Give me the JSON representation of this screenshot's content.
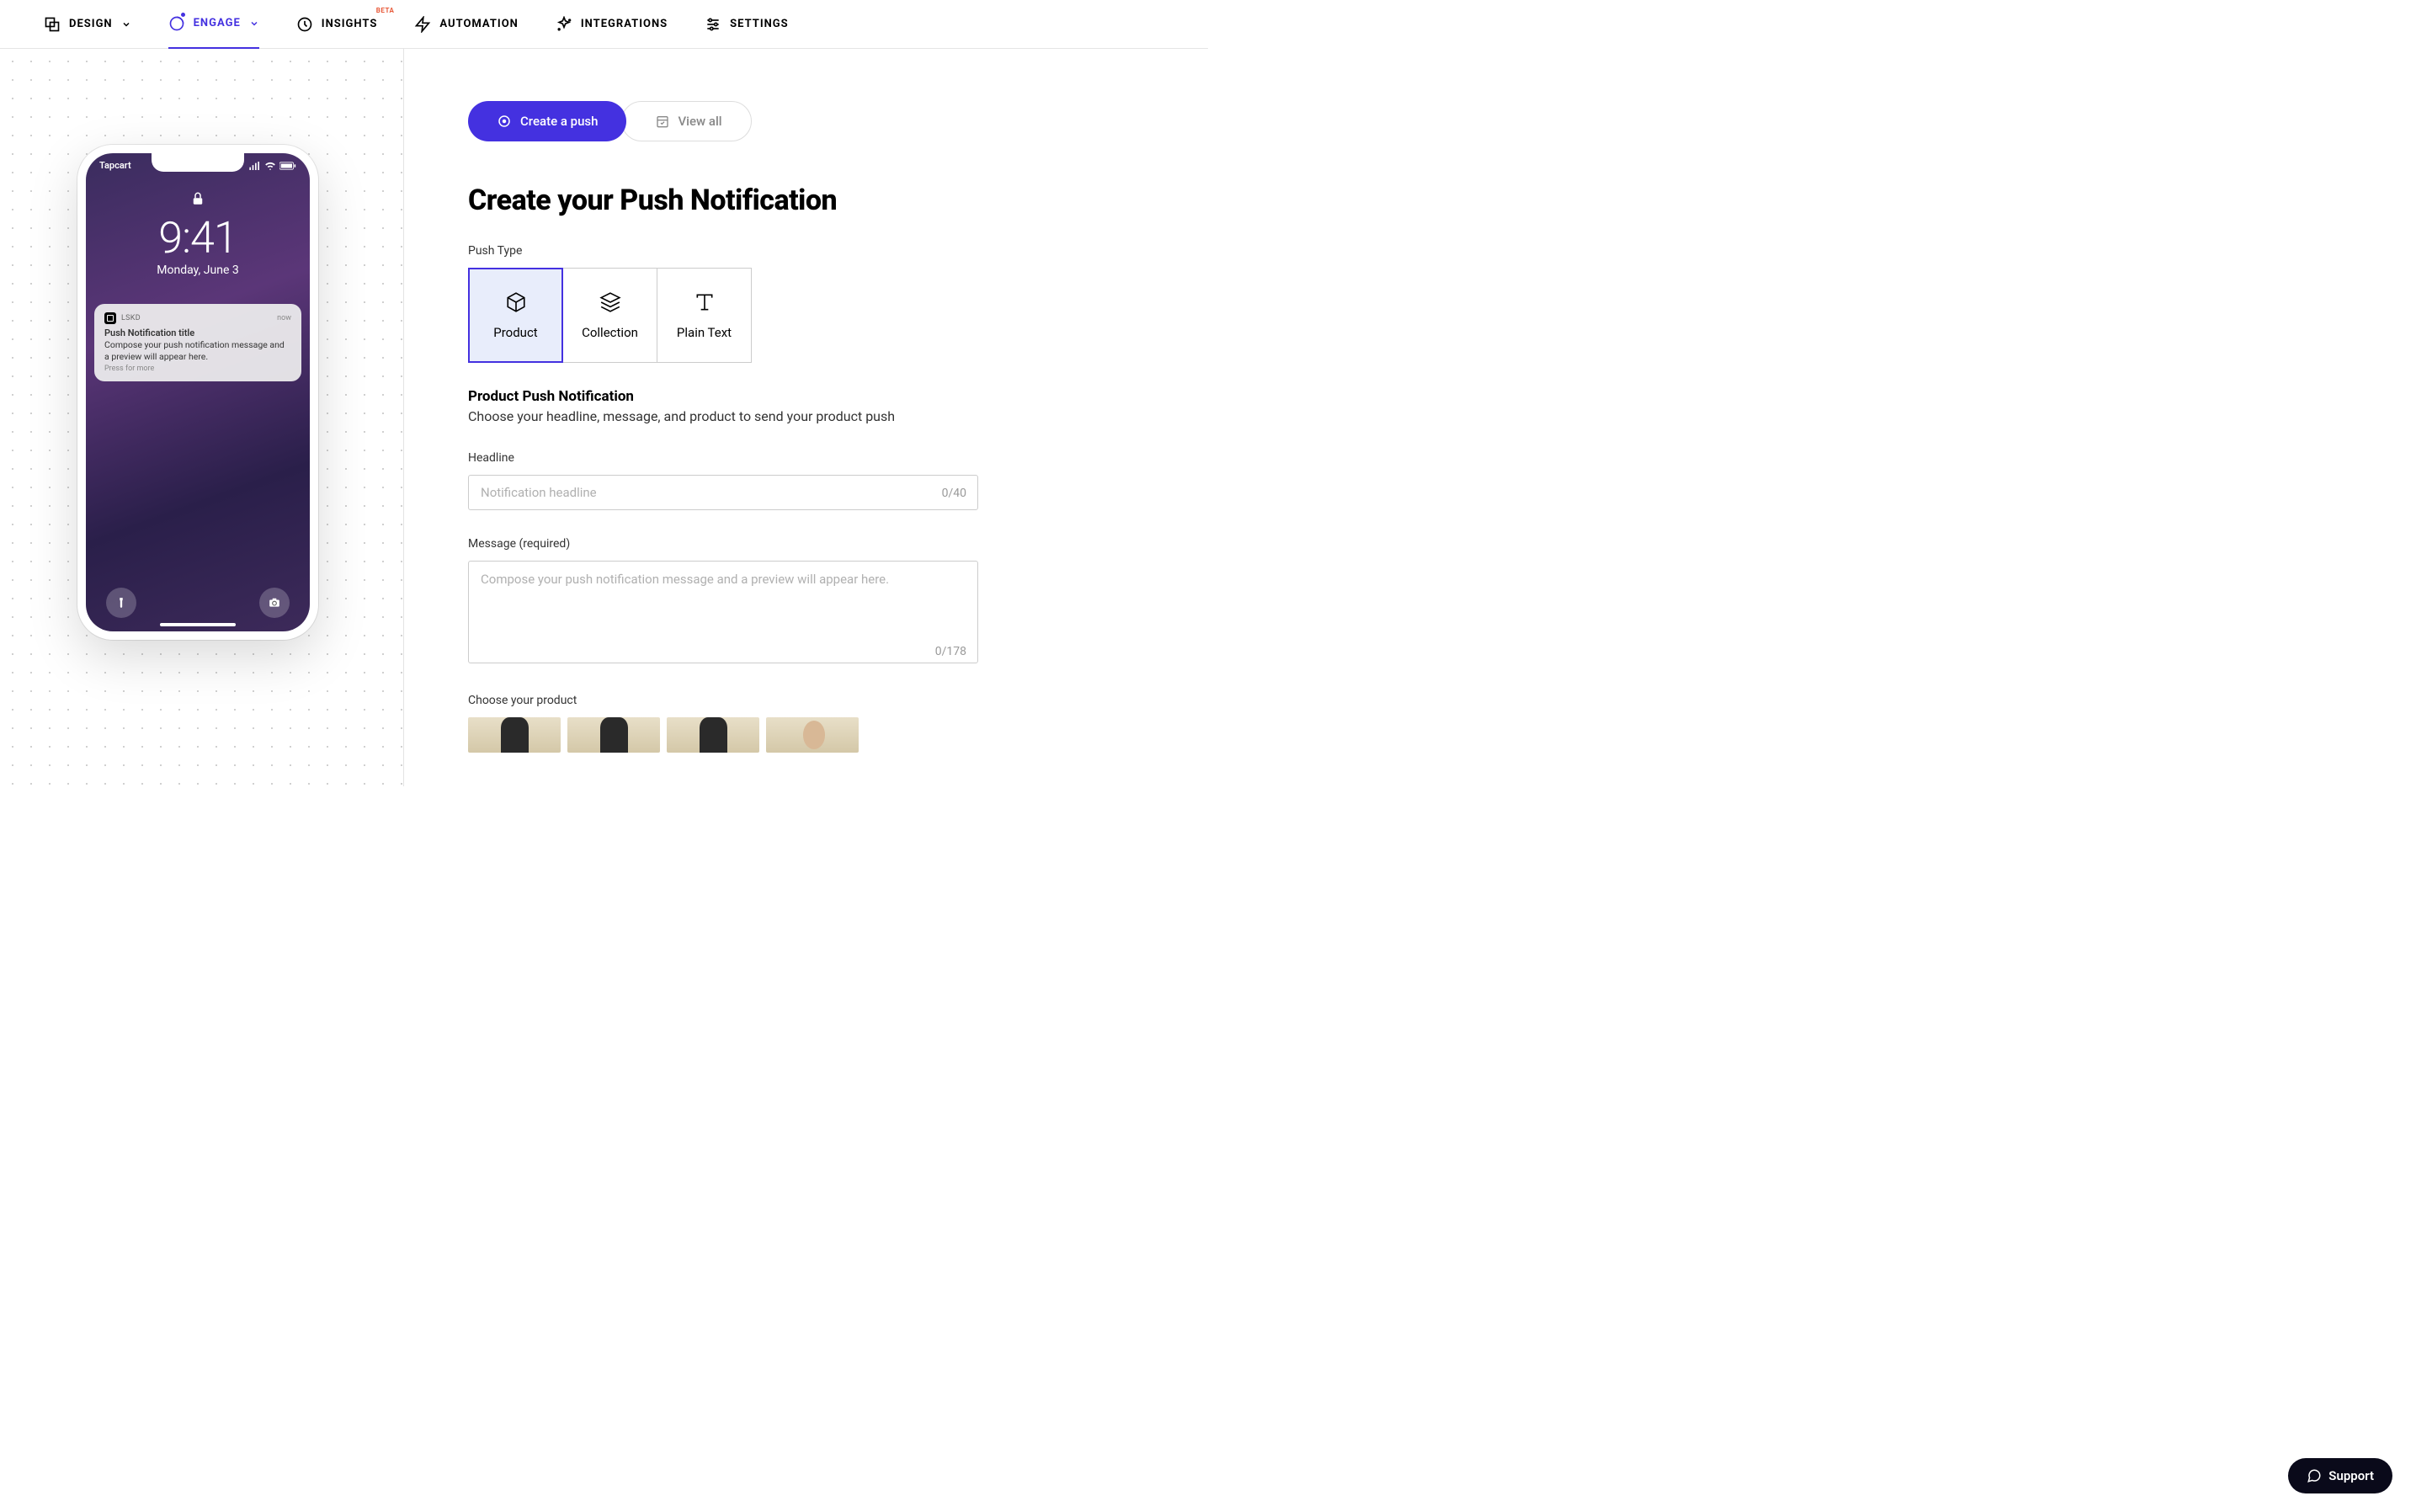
{
  "nav": {
    "design": "Design",
    "engage": "Engage",
    "insights": "Insights",
    "insights_badge": "BETA",
    "automation": "Automation",
    "integrations": "Integrations",
    "settings": "Settings"
  },
  "phone": {
    "carrier": "Tapcart",
    "time": "9:41",
    "date": "Monday, June 3",
    "notif_app": "LSKD",
    "notif_when": "now",
    "notif_title": "Push Notification title",
    "notif_body": "Compose your push notification message and a preview will appear here.",
    "notif_more": "Press for more"
  },
  "actions": {
    "create_push": "Create a push",
    "view_all": "View all"
  },
  "page": {
    "title": "Create your Push Notification",
    "push_type_label": "Push Type",
    "types": {
      "product": "Product",
      "collection": "Collection",
      "plaintext": "Plain Text"
    },
    "section_title": "Product Push Notification",
    "section_desc": "Choose your headline, message, and product to send your product push",
    "headline_label": "Headline",
    "headline_placeholder": "Notification headline",
    "headline_counter": "0/40",
    "message_label": "Message (required)",
    "message_placeholder": "Compose your push notification message and a preview will appear here.",
    "message_counter": "0/178",
    "choose_product_label": "Choose your product"
  },
  "support": {
    "label": "Support"
  }
}
